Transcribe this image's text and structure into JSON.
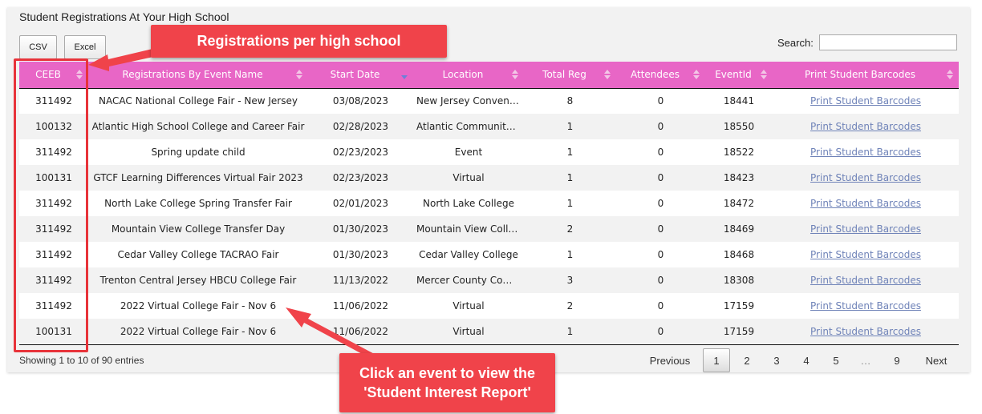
{
  "panel": {
    "title": "Student Registrations At Your High School",
    "buttons": {
      "csv": "CSV",
      "excel": "Excel"
    },
    "search": {
      "label": "Search:",
      "value": ""
    }
  },
  "table": {
    "columns": [
      "CEEB",
      "Registrations By Event Name",
      "Start Date",
      "Location",
      "Total Reg",
      "Attendees",
      "EventId",
      "Print Student Barcodes"
    ],
    "sorted_column": "Start Date",
    "rows": [
      {
        "ceeb": "311492",
        "event": "NACAC National College Fair - New Jersey",
        "date": "03/08/2023",
        "location": "New Jersey Conventi...",
        "total": "8",
        "attendees": "0",
        "eventid": "18441",
        "print": "Print Student Barcodes"
      },
      {
        "ceeb": "100132",
        "event": "Atlantic High School College and Career Fair",
        "date": "02/28/2023",
        "location": "Atlantic Community ...",
        "total": "1",
        "attendees": "0",
        "eventid": "18550",
        "print": "Print Student Barcodes"
      },
      {
        "ceeb": "311492",
        "event": "Spring update child",
        "date": "02/23/2023",
        "location": "Event",
        "total": "1",
        "attendees": "0",
        "eventid": "18522",
        "print": "Print Student Barcodes"
      },
      {
        "ceeb": "100131",
        "event": "GTCF Learning Differences Virtual Fair 2023",
        "date": "02/23/2023",
        "location": "Virtual",
        "total": "1",
        "attendees": "0",
        "eventid": "18423",
        "print": "Print Student Barcodes"
      },
      {
        "ceeb": "311492",
        "event": "North Lake College Spring Transfer Fair",
        "date": "02/01/2023",
        "location": "North Lake College",
        "total": "1",
        "attendees": "0",
        "eventid": "18472",
        "print": "Print Student Barcodes"
      },
      {
        "ceeb": "311492",
        "event": "Mountain View College Transfer Day",
        "date": "01/30/2023",
        "location": "Mountain View College",
        "total": "2",
        "attendees": "0",
        "eventid": "18469",
        "print": "Print Student Barcodes"
      },
      {
        "ceeb": "311492",
        "event": "Cedar Valley College TACRAO Fair",
        "date": "01/30/2023",
        "location": "Cedar Valley College",
        "total": "1",
        "attendees": "0",
        "eventid": "18468",
        "print": "Print Student Barcodes"
      },
      {
        "ceeb": "311492",
        "event": "Trenton Central Jersey HBCU College Fair",
        "date": "11/13/2022",
        "location": "Mercer County Comm...",
        "total": "3",
        "attendees": "0",
        "eventid": "18308",
        "print": "Print Student Barcodes"
      },
      {
        "ceeb": "311492",
        "event": "2022 Virtual College Fair - Nov 6",
        "date": "11/06/2022",
        "location": "Virtual",
        "total": "2",
        "attendees": "0",
        "eventid": "17159",
        "print": "Print Student Barcodes"
      },
      {
        "ceeb": "100131",
        "event": "2022 Virtual College Fair - Nov 6",
        "date": "11/06/2022",
        "location": "Virtual",
        "total": "1",
        "attendees": "0",
        "eventid": "17159",
        "print": "Print Student Barcodes"
      }
    ]
  },
  "footer": {
    "info": "Showing 1 to 10 of 90 entries",
    "pagination": [
      "Previous",
      "1",
      "2",
      "3",
      "4",
      "5",
      "…",
      "9",
      "Next"
    ],
    "current_page": "1"
  },
  "annotations": {
    "top": "Registrations per high school",
    "bottom_line1": "Click an event to view the",
    "bottom_line2": "'Student Interest Report'"
  },
  "colors": {
    "header_bg": "#e866c6",
    "link": "#6f83b8",
    "callout": "#f0434a"
  }
}
